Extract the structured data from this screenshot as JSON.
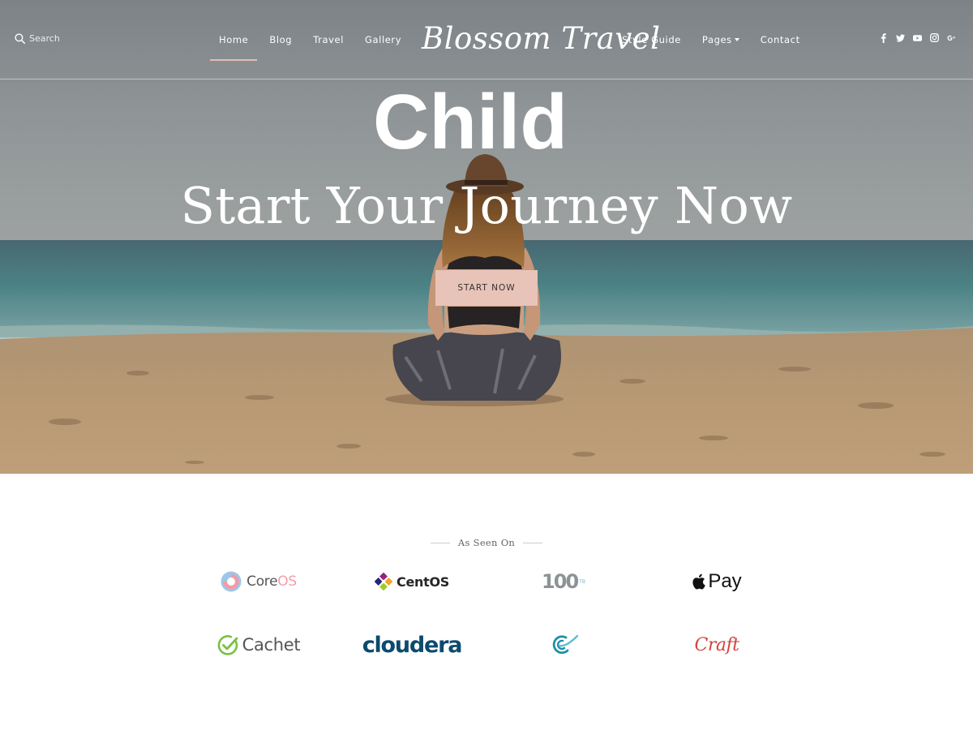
{
  "header": {
    "search_placeholder": "Search",
    "nav_left": [
      "Home",
      "Blog",
      "Travel",
      "Gallery"
    ],
    "logo": "Blossom Travel",
    "nav_right": [
      "Style Guide",
      "Pages",
      "Contact"
    ],
    "active_nav": "Home",
    "social_icons": [
      "facebook-icon",
      "twitter-icon",
      "youtube-icon",
      "instagram-icon",
      "google-plus-icon"
    ]
  },
  "hero": {
    "overlay_label": "Child",
    "title": "Start Your Journey Now",
    "cta_label": "START NOW"
  },
  "seen_on": {
    "heading": "As Seen On",
    "brands": {
      "coreos": {
        "core": "Core",
        "os": "OS"
      },
      "centos": "CentOS",
      "hundred": "100",
      "hundred_sup": "TB",
      "applepay": "Pay",
      "cachet": "Cachet",
      "cloudera": "cloudera",
      "craft": "Craft"
    }
  },
  "colors": {
    "accent": "#e8c3b8",
    "active_underline": "#e5bdb0",
    "cloudera": "#0c4a6e",
    "craft": "#d2453d",
    "cachet": "#7ac143"
  }
}
